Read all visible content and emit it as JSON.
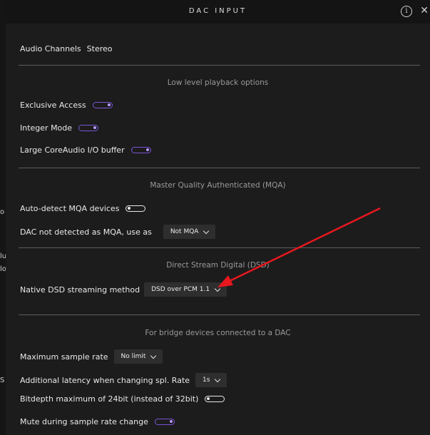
{
  "background": {
    "fragments": [
      "o",
      "lu",
      "lo",
      "S"
    ]
  },
  "dialog": {
    "title": "DAC INPUT",
    "info_glyph": "i",
    "close_glyph": "✕",
    "icons": {
      "info": "info-icon",
      "close": "close-icon"
    }
  },
  "settings": {
    "audio_channels": {
      "label": "Audio Channels",
      "value": "Stereo"
    },
    "low_level_header": "Low level playback options",
    "exclusive_access": {
      "label": "Exclusive Access",
      "on": true
    },
    "integer_mode": {
      "label": "Integer Mode",
      "on": true
    },
    "large_buffer": {
      "label": "Large CoreAudio I/O buffer",
      "on": true
    },
    "mqa_header": "Master Quality Authenticated (MQA)",
    "auto_detect_mqa": {
      "label": "Auto-detect MQA devices",
      "on": false
    },
    "dac_not_mqa": {
      "label": "DAC not detected as MQA, use as",
      "value": "Not MQA"
    },
    "dsd_header": "Direct Stream Digital (DSD)",
    "native_dsd": {
      "label": "Native DSD streaming method",
      "value": "DSD over PCM 1.1"
    },
    "bridge_header": "For bridge devices connected to a DAC",
    "max_sample_rate": {
      "label": "Maximum sample rate",
      "value": "No limit"
    },
    "additional_latency": {
      "label": "Additional latency when changing spl. Rate",
      "value": "1s"
    },
    "bitdepth_24": {
      "label": "Bitdepth maximum of 24bit (instead of 32bit)",
      "on": false
    },
    "mute_during_change": {
      "label": "Mute during sample rate change",
      "on": true
    }
  },
  "colors": {
    "background": "#1c1c1c",
    "titlebar": "#141414",
    "toggle_on": "#7a52d6",
    "toggle_off": "#e8e8e8",
    "annotation_arrow": "#e8171e"
  }
}
